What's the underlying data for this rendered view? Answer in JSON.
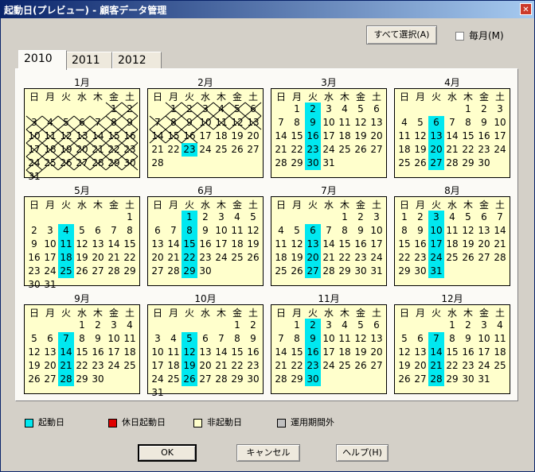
{
  "window": {
    "title": "起動日(プレビュー) - 顧客データ管理",
    "close": "✕"
  },
  "toolbar": {
    "select_all": "すべて選択(A)",
    "monthly": "毎月(M)",
    "monthly_checked": false
  },
  "tabs": [
    "2010",
    "2011",
    "2012"
  ],
  "active_tab": "2010",
  "weekday_headers": [
    "日",
    "月",
    "火",
    "水",
    "木",
    "金",
    "土"
  ],
  "months": [
    {
      "label": "1月",
      "start": 5,
      "days": 31,
      "on": [],
      "out_all": true
    },
    {
      "label": "2月",
      "start": 1,
      "days": 28,
      "on": [
        23
      ],
      "out_until": 16
    },
    {
      "label": "3月",
      "start": 1,
      "days": 31,
      "on": [
        2,
        9,
        16,
        23,
        30
      ]
    },
    {
      "label": "4月",
      "start": 4,
      "days": 30,
      "on": [
        6,
        13,
        20,
        27
      ]
    },
    {
      "label": "5月",
      "start": 6,
      "days": 31,
      "on": [
        4,
        11,
        18,
        25
      ]
    },
    {
      "label": "6月",
      "start": 2,
      "days": 30,
      "on": [
        1,
        8,
        15,
        22,
        29
      ]
    },
    {
      "label": "7月",
      "start": 4,
      "days": 31,
      "on": [
        6,
        13,
        20,
        27
      ]
    },
    {
      "label": "8月",
      "start": 0,
      "days": 31,
      "on": [
        3,
        10,
        17,
        24,
        31
      ]
    },
    {
      "label": "9月",
      "start": 3,
      "days": 30,
      "on": [
        7,
        14,
        21,
        28
      ]
    },
    {
      "label": "10月",
      "start": 5,
      "days": 31,
      "on": [
        5,
        12,
        19,
        26
      ]
    },
    {
      "label": "11月",
      "start": 1,
      "days": 30,
      "on": [
        2,
        9,
        16,
        23,
        30
      ]
    },
    {
      "label": "12月",
      "start": 3,
      "days": 31,
      "on": [
        7,
        14,
        21,
        28
      ]
    }
  ],
  "legend": [
    {
      "label": "起動日",
      "color": "#00e8f0"
    },
    {
      "label": "休日起動日",
      "color": "#e00000"
    },
    {
      "label": "非起動日",
      "color": "#ffffcc"
    },
    {
      "label": "運用期間外",
      "color": "#c0c0c0"
    }
  ],
  "buttons": {
    "ok": "OK",
    "cancel": "キャンセル",
    "help": "ヘルプ(H)"
  }
}
